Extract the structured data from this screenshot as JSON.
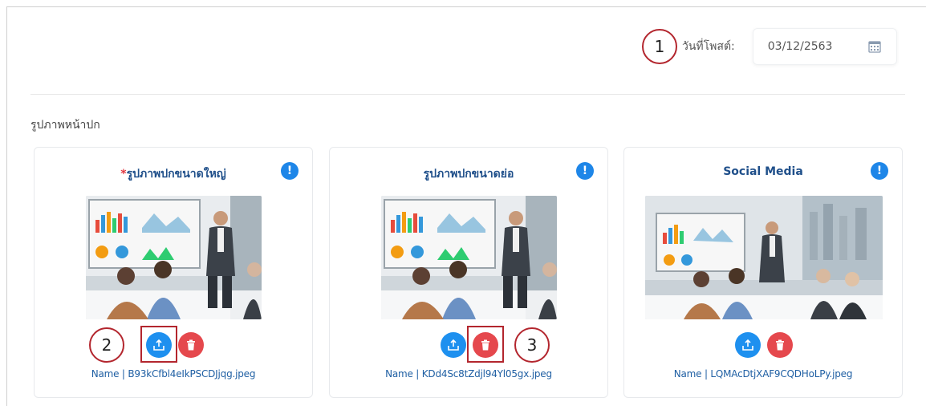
{
  "post_date": {
    "step_number": "1",
    "label": "วันที่โพสต์:",
    "value": "03/12/2563",
    "icon": "calendar-icon"
  },
  "section": {
    "title": "รูปภาพหน้าปก"
  },
  "cards": [
    {
      "required_mark": "*",
      "title": "รูปภาพปกขนาดใหญ่",
      "info_icon": "!",
      "file_name": "Name | B93kCfbl4eIkPSCDJjqg.jpeg",
      "callout_number": "2"
    },
    {
      "required_mark": "",
      "title": "รูปภาพปกขนาดย่อ",
      "info_icon": "!",
      "file_name": "Name | KDd4Sc8tZdjl94Yl05gx.jpeg",
      "callout_number": "3"
    },
    {
      "required_mark": "",
      "title": "Social Media",
      "info_icon": "!",
      "file_name": "Name | LQMAcDtjXAF9CQDHoLPy.jpeg"
    }
  ],
  "icons": {
    "upload": "upload-icon",
    "delete": "trash-icon",
    "info": "info-icon"
  },
  "colors": {
    "title": "#1f4f8a",
    "upload": "#1e90ef",
    "delete": "#e5484d",
    "info": "#1e86e8",
    "callout": "#b3262e"
  }
}
